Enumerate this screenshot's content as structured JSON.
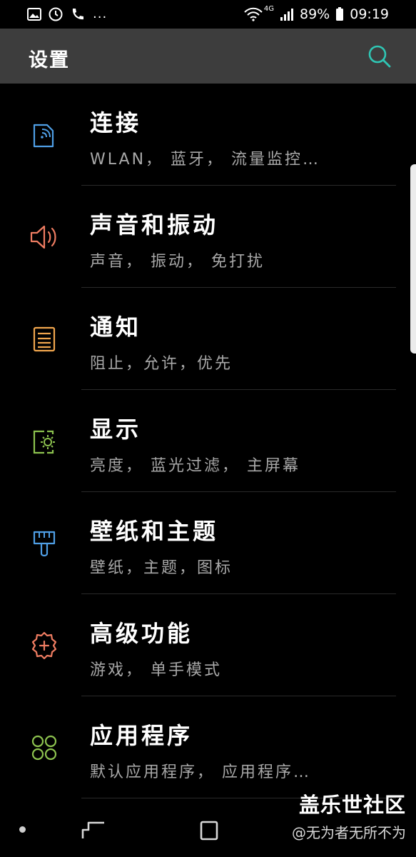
{
  "status_bar": {
    "more": "...",
    "network": "4G",
    "battery": "89%",
    "time": "09:19"
  },
  "header": {
    "title": "设置",
    "accent": "#2fc6b4"
  },
  "items": [
    {
      "title": "连接",
      "subtitle": "WLAN， 蓝牙， 流量监控…",
      "icon": "connection-icon",
      "color": "#4f9fe6"
    },
    {
      "title": "声音和振动",
      "subtitle": "声音， 振动， 免打扰",
      "icon": "speaker-icon",
      "color": "#f07d62"
    },
    {
      "title": "通知",
      "subtitle": "阻止，允许，优先",
      "icon": "notification-icon",
      "color": "#f1a64d"
    },
    {
      "title": "显示",
      "subtitle": "亮度， 蓝光过滤， 主屏幕",
      "icon": "display-icon",
      "color": "#8dc34f"
    },
    {
      "title": "壁纸和主题",
      "subtitle": "壁纸，主题，图标",
      "icon": "brush-icon",
      "color": "#4f9fe6"
    },
    {
      "title": "高级功能",
      "subtitle": "游戏， 单手模式",
      "icon": "gear-plus-icon",
      "color": "#f07d62"
    },
    {
      "title": "应用程序",
      "subtitle": "默认应用程序， 应用程序…",
      "icon": "apps-icon",
      "color": "#8dc34f"
    }
  ],
  "watermark": {
    "main": "盖乐世社区",
    "sub": "@无为者无所不为"
  }
}
